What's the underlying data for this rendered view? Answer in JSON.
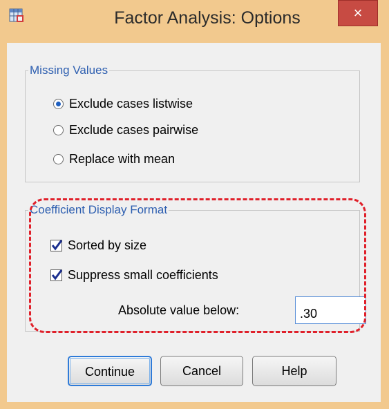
{
  "window": {
    "title": "Factor Analysis: Options",
    "close_glyph": "×",
    "app_icon": "spss-table-icon"
  },
  "missing_values": {
    "legend": "Missing Values",
    "options": [
      {
        "label": "Exclude cases listwise",
        "checked": true
      },
      {
        "label": "Exclude cases pairwise",
        "checked": false
      },
      {
        "label": "Replace with mean",
        "checked": false
      }
    ]
  },
  "coefficient_display": {
    "legend": "Coefficient Display Format",
    "sorted_label": "Sorted by size",
    "sorted_checked": true,
    "suppress_label": "Suppress small coefficients",
    "suppress_checked": true,
    "absolute_label": "Absolute value below:",
    "absolute_value": ".30"
  },
  "buttons": {
    "continue": "Continue",
    "cancel": "Cancel",
    "help": "Help"
  },
  "colors": {
    "titlebar": "#f2c98e",
    "close": "#c74b43",
    "legend_text": "#2e5fb0",
    "highlight": "#e0202a"
  }
}
